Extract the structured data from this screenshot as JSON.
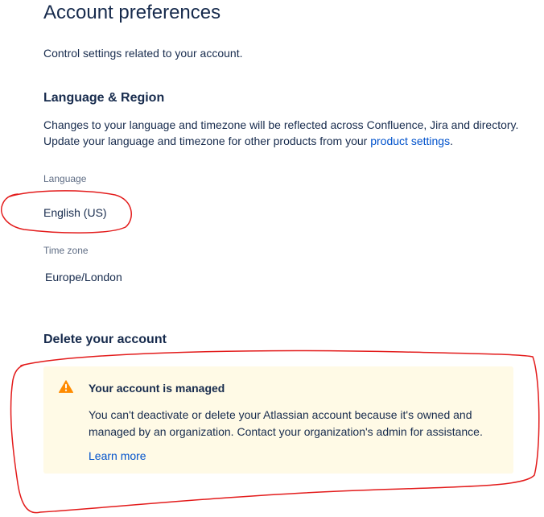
{
  "header": {
    "title": "Account preferences",
    "intro": "Control settings related to your account."
  },
  "language_region": {
    "heading": "Language & Region",
    "description_line1": "Changes to your language and timezone will be reflected across Confluence, Jira and directory.",
    "description_line2_prefix": "Update your language and timezone for other products from your ",
    "product_settings_link": "product settings",
    "description_line2_suffix": ".",
    "language_label": "Language",
    "language_value": "English (US)",
    "timezone_label": "Time zone",
    "timezone_value": "Europe/London"
  },
  "delete_account": {
    "heading": "Delete your account",
    "warning_icon": "warning-triangle-icon",
    "warning_title": "Your account is managed",
    "warning_body": "You can't deactivate or delete your Atlassian account because it's owned and managed by an organization. Contact your organization's admin for assistance.",
    "learn_more": "Learn more"
  },
  "colors": {
    "text": "#172b4d",
    "link": "#0052cc",
    "muted_label": "#5e6c84",
    "warning_background": "#fffae6",
    "warning_icon": "#ff8b00",
    "annotation": "#e31b1b"
  }
}
